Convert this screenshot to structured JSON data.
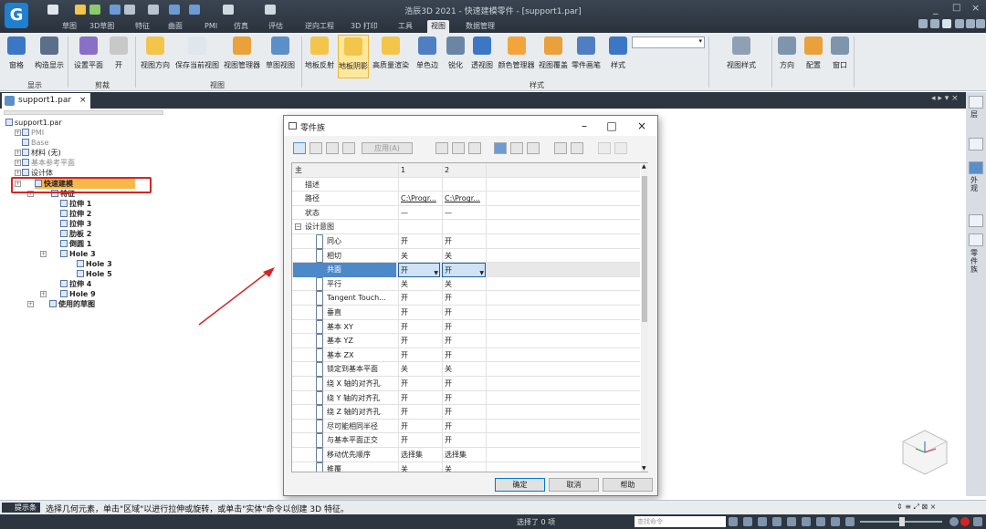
{
  "app": {
    "window_title": "浩辰3D 2021 - 快速建模零件 - [support1.par]",
    "logo_letter": "G",
    "tabs": [
      "草图",
      "3D草图",
      "特征",
      "曲面",
      "PMI",
      "仿真",
      "评估",
      "逆向工程",
      "3D 打印",
      "工具",
      "视图",
      "数据管理"
    ],
    "active_tab": "视图"
  },
  "ribbon": {
    "buttons": [
      {
        "label": "窗格",
        "icon": "pane-icon"
      },
      {
        "label": "构造显示",
        "icon": "construction-display-icon"
      },
      {
        "label": "设置平面",
        "icon": "set-plane-icon"
      },
      {
        "label": "开",
        "icon": "clip-open-icon"
      },
      {
        "label": "视图方向",
        "icon": "view-orientation-icon"
      },
      {
        "label": "保存当前视图",
        "icon": "save-view-icon"
      },
      {
        "label": "视图管理器",
        "icon": "view-manager-icon"
      },
      {
        "label": "草图视图",
        "icon": "sketch-view-icon"
      },
      {
        "label": "地板反射",
        "icon": "floor-reflection-icon"
      },
      {
        "label": "地板阴影",
        "icon": "floor-shadow-icon"
      },
      {
        "label": "高质量渲染",
        "icon": "high-quality-render-icon"
      },
      {
        "label": "单色边",
        "icon": "mono-edge-icon"
      },
      {
        "label": "锐化",
        "icon": "sharpen-icon"
      },
      {
        "label": "透视图",
        "icon": "perspective-icon"
      },
      {
        "label": "颜色管理器",
        "icon": "color-manager-icon"
      },
      {
        "label": "视图覆盖",
        "icon": "view-override-icon"
      },
      {
        "label": "零件画笔",
        "icon": "part-painter-icon"
      },
      {
        "label": "样式",
        "icon": "style-icon"
      },
      {
        "label": "视图样式",
        "icon": "view-style-icon"
      },
      {
        "label": "方向",
        "icon": "orient-icon"
      },
      {
        "label": "配置",
        "icon": "config-icon"
      },
      {
        "label": "窗口",
        "icon": "window-icon"
      }
    ],
    "groups": [
      "显示",
      "剪裁",
      "视图",
      "样式"
    ],
    "active_button": "地板阴影"
  },
  "document": {
    "tab_label": "support1.par"
  },
  "tree": {
    "items": [
      {
        "label": "support1.par",
        "style": "normal"
      },
      {
        "label": "PMI",
        "style": "grey"
      },
      {
        "label": "Base",
        "style": "grey"
      },
      {
        "label": "材料 (无)",
        "style": "normal"
      },
      {
        "label": "基本参考平面",
        "style": "grey"
      },
      {
        "label": "设计体",
        "style": "normal"
      },
      {
        "label": "快速建模",
        "style": "selected"
      },
      {
        "label": "特征",
        "style": "bold"
      },
      {
        "label": "拉伸 1",
        "style": "bold"
      },
      {
        "label": "拉伸 2",
        "style": "bold"
      },
      {
        "label": "拉伸 3",
        "style": "bold"
      },
      {
        "label": "肋板 2",
        "style": "bold"
      },
      {
        "label": "倒圆 1",
        "style": "bold"
      },
      {
        "label": "Hole 3",
        "style": "bold"
      },
      {
        "label": "Hole 3",
        "style": "bold"
      },
      {
        "label": "Hole 5",
        "style": "bold"
      },
      {
        "label": "拉伸 4",
        "style": "bold"
      },
      {
        "label": "Hole 9",
        "style": "bold"
      },
      {
        "label": "使用的草图",
        "style": "bold"
      }
    ]
  },
  "dialog": {
    "title": "零件族",
    "apply_label": "应用(A)",
    "headers": [
      "主",
      "1",
      "2"
    ],
    "rows": [
      {
        "name": "描述",
        "v1": "",
        "v2": "",
        "sub": false
      },
      {
        "name": "路径",
        "v1": "C:\\Progr...",
        "v2": "C:\\Progr...",
        "sub": false
      },
      {
        "name": "状态",
        "v1": "—",
        "v2": "—",
        "sub": false
      },
      {
        "name": "设计意图",
        "v1": "",
        "v2": "",
        "sub": false,
        "group": true
      },
      {
        "name": "同心",
        "v1": "开",
        "v2": "开",
        "sub": true
      },
      {
        "name": "相切",
        "v1": "关",
        "v2": "关",
        "sub": true
      },
      {
        "name": "共面",
        "v1": "开",
        "v2": "开",
        "sub": true,
        "selected": true
      },
      {
        "name": "平行",
        "v1": "关",
        "v2": "关",
        "sub": true
      },
      {
        "name": "Tangent Touch...",
        "v1": "开",
        "v2": "开",
        "sub": true
      },
      {
        "name": "垂直",
        "v1": "开",
        "v2": "开",
        "sub": true
      },
      {
        "name": "基本 XY",
        "v1": "开",
        "v2": "开",
        "sub": true
      },
      {
        "name": "基本 YZ",
        "v1": "开",
        "v2": "开",
        "sub": true
      },
      {
        "name": "基本 ZX",
        "v1": "开",
        "v2": "开",
        "sub": true
      },
      {
        "name": "锁定到基本平面",
        "v1": "关",
        "v2": "关",
        "sub": true
      },
      {
        "name": "绕 X 轴的对齐孔",
        "v1": "开",
        "v2": "开",
        "sub": true
      },
      {
        "name": "绕 Y 轴的对齐孔",
        "v1": "开",
        "v2": "开",
        "sub": true
      },
      {
        "name": "绕 Z 轴的对齐孔",
        "v1": "开",
        "v2": "开",
        "sub": true
      },
      {
        "name": "尽可能相同半径",
        "v1": "开",
        "v2": "开",
        "sub": true
      },
      {
        "name": "与基本平面正交",
        "v1": "开",
        "v2": "开",
        "sub": true
      },
      {
        "name": "移动优先顺序",
        "v1": "选择集",
        "v2": "选择集",
        "sub": true
      },
      {
        "name": "推覆",
        "v1": "关",
        "v2": "关",
        "sub": true
      }
    ],
    "ok_label": "确定",
    "cancel_label": "取消",
    "help_label": "帮助"
  },
  "right_panel": {
    "labels": [
      "层",
      "外观",
      "零件族"
    ]
  },
  "command_bar": {
    "tag": "提示条",
    "text": "选择几何元素，单击\"区域\"以进行拉伸或旋转，或单击\"实体\"命令以创建 3D 特征。"
  },
  "status_bar": {
    "selection": "选择了 0 项",
    "search_placeholder": "查找命令"
  },
  "colors": {
    "accent": "#4d88c8",
    "highlight": "#d42525",
    "selection": "#f7b84b"
  }
}
